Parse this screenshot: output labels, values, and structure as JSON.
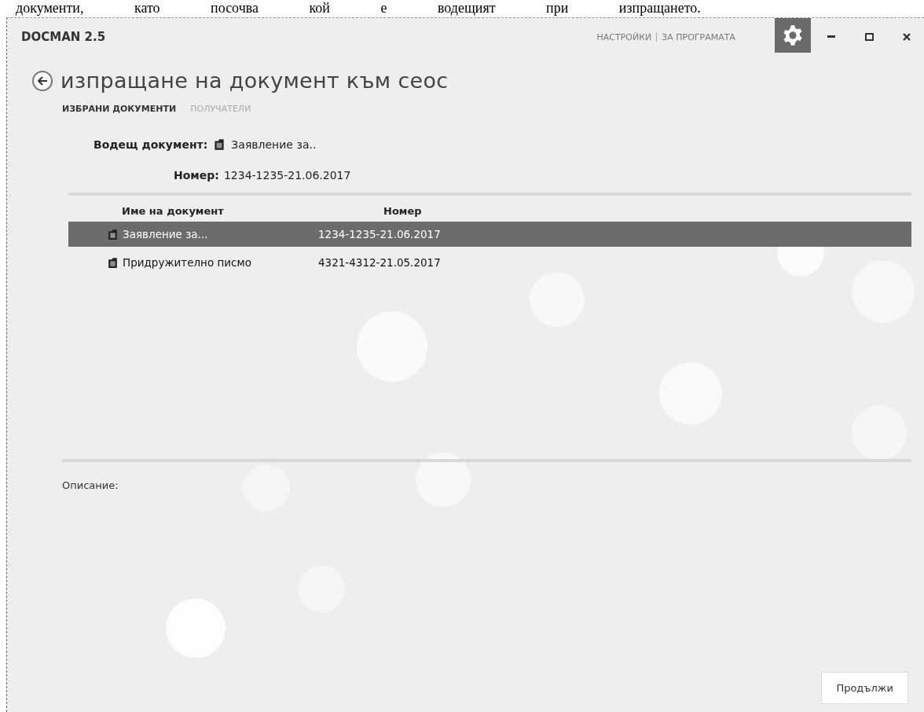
{
  "document_text": "документи, като посочва кой е водещият при изпращането.",
  "window": {
    "title": "DOCMAN 2.5",
    "links": [
      "НАСТРОЙКИ",
      "ЗА ПРОГРАМАТА"
    ]
  },
  "page": {
    "heading": "изпращане на документ към сеос"
  },
  "tabs": [
    {
      "label": "ИЗБРАНИ ДОКУМЕНТИ",
      "selected": true
    },
    {
      "label": "ПОЛУЧАТЕЛИ",
      "selected": false
    }
  ],
  "lead": {
    "label": "Водещ документ:",
    "document": "Заявление за..",
    "number_label": "Номер:",
    "number": "1234-1235-21.06.2017"
  },
  "table": {
    "columns": [
      "Име на документ",
      "Номер"
    ],
    "rows": [
      {
        "name": "Заявление за...",
        "number": "1234-1235-21.06.2017",
        "selected": true
      },
      {
        "name": "Придружително писмо",
        "number": "4321-4312-21.05.2017",
        "selected": false
      }
    ]
  },
  "description": {
    "label": "Описание:"
  },
  "buttons": [
    "Продължи"
  ]
}
